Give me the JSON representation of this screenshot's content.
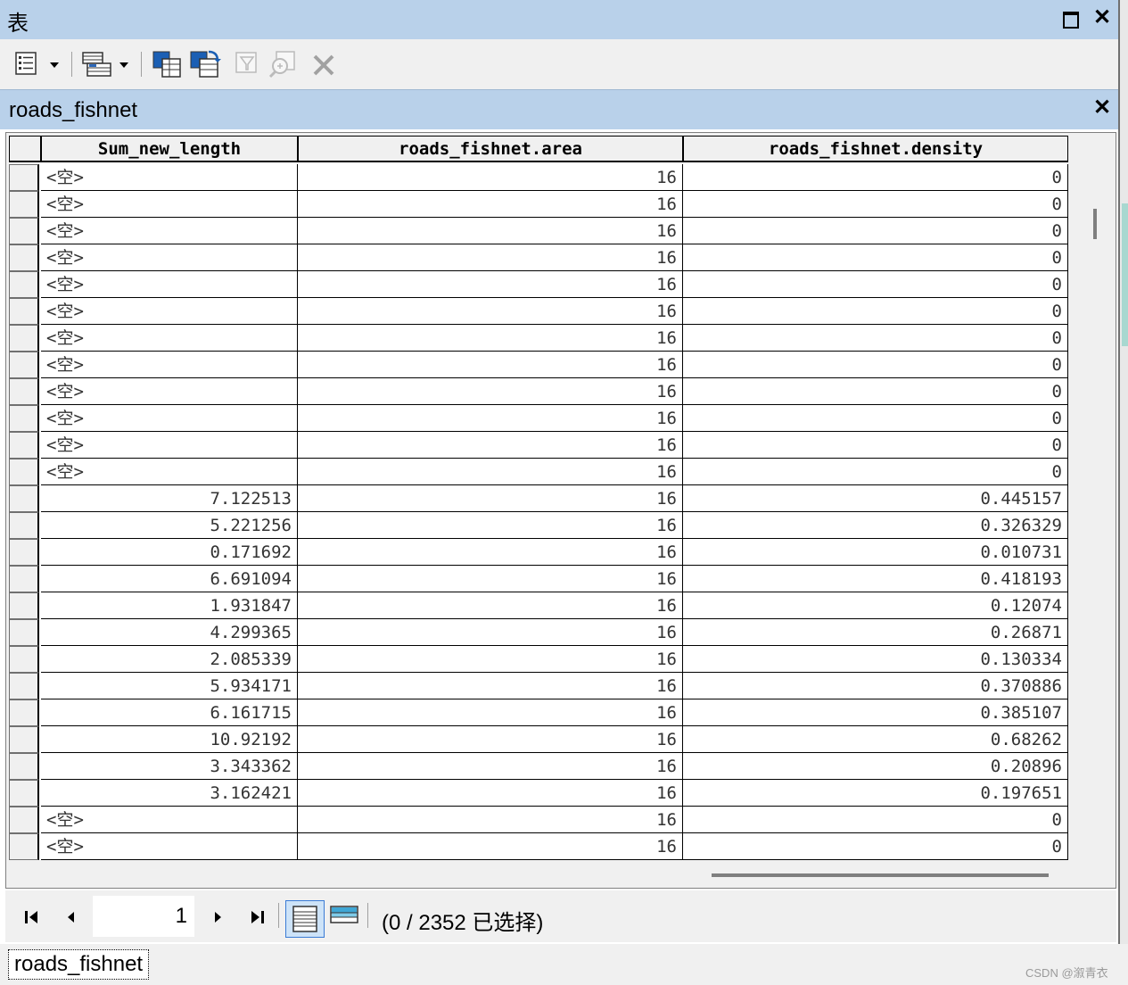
{
  "window": {
    "title": "表"
  },
  "table": {
    "name": "roads_fishnet"
  },
  "columns": [
    {
      "label": "Sum_new_length"
    },
    {
      "label": "roads_fishnet.area"
    },
    {
      "label": "roads_fishnet.density"
    }
  ],
  "rows": [
    [
      "<空>",
      "16",
      "0"
    ],
    [
      "<空>",
      "16",
      "0"
    ],
    [
      "<空>",
      "16",
      "0"
    ],
    [
      "<空>",
      "16",
      "0"
    ],
    [
      "<空>",
      "16",
      "0"
    ],
    [
      "<空>",
      "16",
      "0"
    ],
    [
      "<空>",
      "16",
      "0"
    ],
    [
      "<空>",
      "16",
      "0"
    ],
    [
      "<空>",
      "16",
      "0"
    ],
    [
      "<空>",
      "16",
      "0"
    ],
    [
      "<空>",
      "16",
      "0"
    ],
    [
      "<空>",
      "16",
      "0"
    ],
    [
      "7.122513",
      "16",
      "0.445157"
    ],
    [
      "5.221256",
      "16",
      "0.326329"
    ],
    [
      "0.171692",
      "16",
      "0.010731"
    ],
    [
      "6.691094",
      "16",
      "0.418193"
    ],
    [
      "1.931847",
      "16",
      "0.12074"
    ],
    [
      "4.299365",
      "16",
      "0.26871"
    ],
    [
      "2.085339",
      "16",
      "0.130334"
    ],
    [
      "5.934171",
      "16",
      "0.370886"
    ],
    [
      "6.161715",
      "16",
      "0.385107"
    ],
    [
      "10.92192",
      "16",
      "0.68262"
    ],
    [
      "3.343362",
      "16",
      "0.20896"
    ],
    [
      "3.162421",
      "16",
      "0.197651"
    ],
    [
      "<空>",
      "16",
      "0"
    ],
    [
      "<空>",
      "16",
      "0"
    ]
  ],
  "nav": {
    "current_page": "1",
    "status": "(0 / 2352 已选择)"
  },
  "bottom_tab": {
    "label": "roads_fishnet"
  },
  "watermark": "CSDN @溆青衣",
  "icons": {
    "toolbar": [
      "table-options-icon",
      "related-tables-icon",
      "select-by-attributes-icon",
      "switch-selection-icon",
      "clear-selection-icon",
      "zoom-to-selected-icon",
      "delete-selected-icon"
    ],
    "nav": [
      "first-record-icon",
      "previous-record-icon",
      "next-record-icon",
      "last-record-icon",
      "show-all-records-icon",
      "show-selected-records-icon"
    ]
  },
  "colors": {
    "titlebar": "#b9d1ea",
    "background": "#f0f0f0",
    "grid_line": "#000000"
  }
}
